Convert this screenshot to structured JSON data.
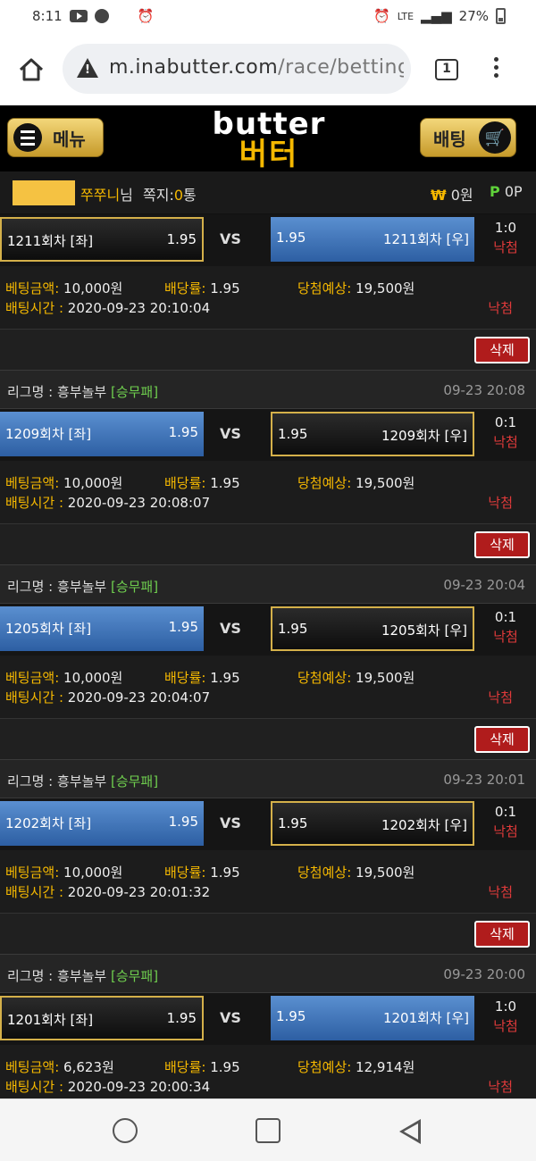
{
  "status_bar": {
    "time": "8:11",
    "network": "LTE",
    "battery": "27%"
  },
  "browser": {
    "url_host": "m.inabutter.com",
    "url_path": "/race/betting_",
    "tab_count": "1"
  },
  "header": {
    "menu_label": "메뉴",
    "logo_en": "butter",
    "logo_ko": "버터",
    "bet_label": "배팅"
  },
  "user": {
    "name": "쭈쭈니",
    "suffix": "님",
    "msg_label": "쪽지:",
    "msg_count": "0",
    "msg_unit": "통",
    "won_symbol": "₩",
    "won_value": "0원",
    "point_symbol": "P",
    "point_value": "0P"
  },
  "labels": {
    "league": "리그명 : ",
    "amount": "베팅금액:",
    "rate": "배당률:",
    "expect": "당첨예상:",
    "time": "배팅시간 : ",
    "vs": "VS",
    "delete": "삭제"
  },
  "entries": [
    {
      "league": "",
      "league_type": "",
      "league_date": "",
      "left_team": "1211회차 [좌]",
      "left_odds": "1.95",
      "right_odds": "1.95",
      "right_team": "1211회차 [우]",
      "selected": "left",
      "score": "1:0",
      "result": "낙첨",
      "amount": "10,000원",
      "rate": "1.95",
      "expect": "19,500원",
      "bet_time": "2020-09-23 20:10:04",
      "status": "낙첨"
    },
    {
      "league": "흥부놀부",
      "league_type": "[승무패]",
      "league_date": "09-23 20:08",
      "left_team": "1209회차 [좌]",
      "left_odds": "1.95",
      "right_odds": "1.95",
      "right_team": "1209회차 [우]",
      "selected": "right",
      "score": "0:1",
      "result": "낙첨",
      "amount": "10,000원",
      "rate": "1.95",
      "expect": "19,500원",
      "bet_time": "2020-09-23 20:08:07",
      "status": "낙첨"
    },
    {
      "league": "흥부놀부",
      "league_type": "[승무패]",
      "league_date": "09-23 20:04",
      "left_team": "1205회차 [좌]",
      "left_odds": "1.95",
      "right_odds": "1.95",
      "right_team": "1205회차 [우]",
      "selected": "right",
      "score": "0:1",
      "result": "낙첨",
      "amount": "10,000원",
      "rate": "1.95",
      "expect": "19,500원",
      "bet_time": "2020-09-23 20:04:07",
      "status": "낙첨"
    },
    {
      "league": "흥부놀부",
      "league_type": "[승무패]",
      "league_date": "09-23 20:01",
      "left_team": "1202회차 [좌]",
      "left_odds": "1.95",
      "right_odds": "1.95",
      "right_team": "1202회차 [우]",
      "selected": "right",
      "score": "0:1",
      "result": "낙첨",
      "amount": "10,000원",
      "rate": "1.95",
      "expect": "19,500원",
      "bet_time": "2020-09-23 20:01:32",
      "status": "낙첨"
    },
    {
      "league": "흥부놀부",
      "league_type": "[승무패]",
      "league_date": "09-23 20:00",
      "left_team": "1201회차 [좌]",
      "left_odds": "1.95",
      "right_odds": "1.95",
      "right_team": "1201회차 [우]",
      "selected": "left",
      "score": "1:0",
      "result": "낙첨",
      "amount": "6,623원",
      "rate": "1.95",
      "expect": "12,914원",
      "bet_time": "2020-09-23 20:00:34",
      "status": "낙첨"
    }
  ]
}
